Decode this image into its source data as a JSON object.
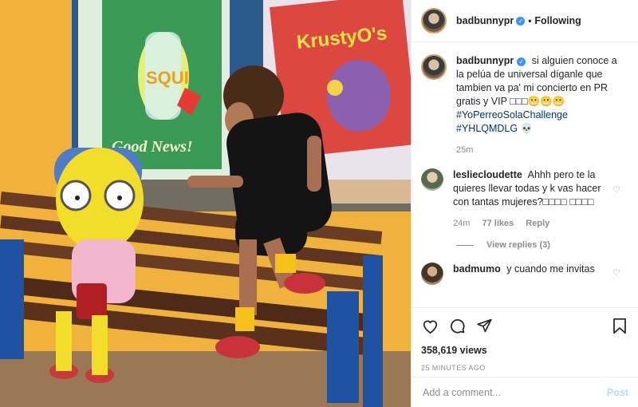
{
  "header": {
    "username": "badbunnypr",
    "separator": "•",
    "follow_status": "Following"
  },
  "caption": {
    "username": "badbunnypr",
    "text": "si alguien conoce a la pelúa de universal díganle que tambien va pa' mi concierto en PR gratis y VIP □□□😬😬😬",
    "hashtag1": "#YoPerreoSolaChallenge",
    "hashtag2": "#YHLQMDLG",
    "skull": "💀",
    "age": "25m"
  },
  "comments": [
    {
      "username": "lesliecloudette",
      "text": "Ahhh pero te la quieres llevar todas y k vas hacer con tantas mujeres?□□□□ □□□□",
      "age": "24m",
      "likes": "77 likes",
      "reply": "Reply",
      "view_replies": "View replies (3)"
    },
    {
      "username": "badmumo",
      "text": "y cuando me invitas"
    }
  ],
  "actions": {
    "views": "358,619 views",
    "timestamp": "25 MINUTES AGO"
  },
  "add_comment": {
    "placeholder": "Add a comment...",
    "post_label": "Post"
  },
  "media_signs": {
    "poster1": "Good News!",
    "poster1_brand": "SQUI",
    "poster2": "KrustyO's"
  }
}
